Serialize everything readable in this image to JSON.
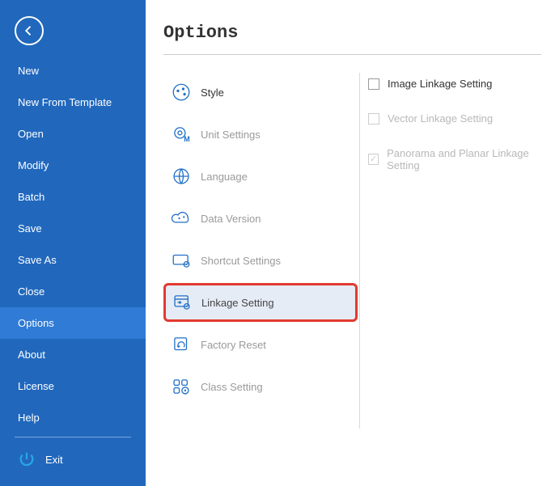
{
  "sidebar": {
    "items": [
      {
        "label": "New"
      },
      {
        "label": "New From Template"
      },
      {
        "label": "Open"
      },
      {
        "label": "Modify"
      },
      {
        "label": "Batch"
      },
      {
        "label": "Save"
      },
      {
        "label": "Save As"
      },
      {
        "label": "Close"
      },
      {
        "label": "Options"
      },
      {
        "label": "About"
      },
      {
        "label": "License"
      },
      {
        "label": "Help"
      }
    ],
    "exit_label": "Exit"
  },
  "page": {
    "title": "Options"
  },
  "options_list": [
    {
      "label": "Style"
    },
    {
      "label": "Unit Settings"
    },
    {
      "label": "Language"
    },
    {
      "label": "Data Version"
    },
    {
      "label": "Shortcut Settings"
    },
    {
      "label": "Linkage Setting"
    },
    {
      "label": "Factory Reset"
    },
    {
      "label": "Class Setting"
    }
  ],
  "linkage_checks": [
    {
      "label": "Image Linkage Setting"
    },
    {
      "label": "Vector Linkage Setting"
    },
    {
      "label": "Panorama and Planar Linkage Setting"
    }
  ]
}
